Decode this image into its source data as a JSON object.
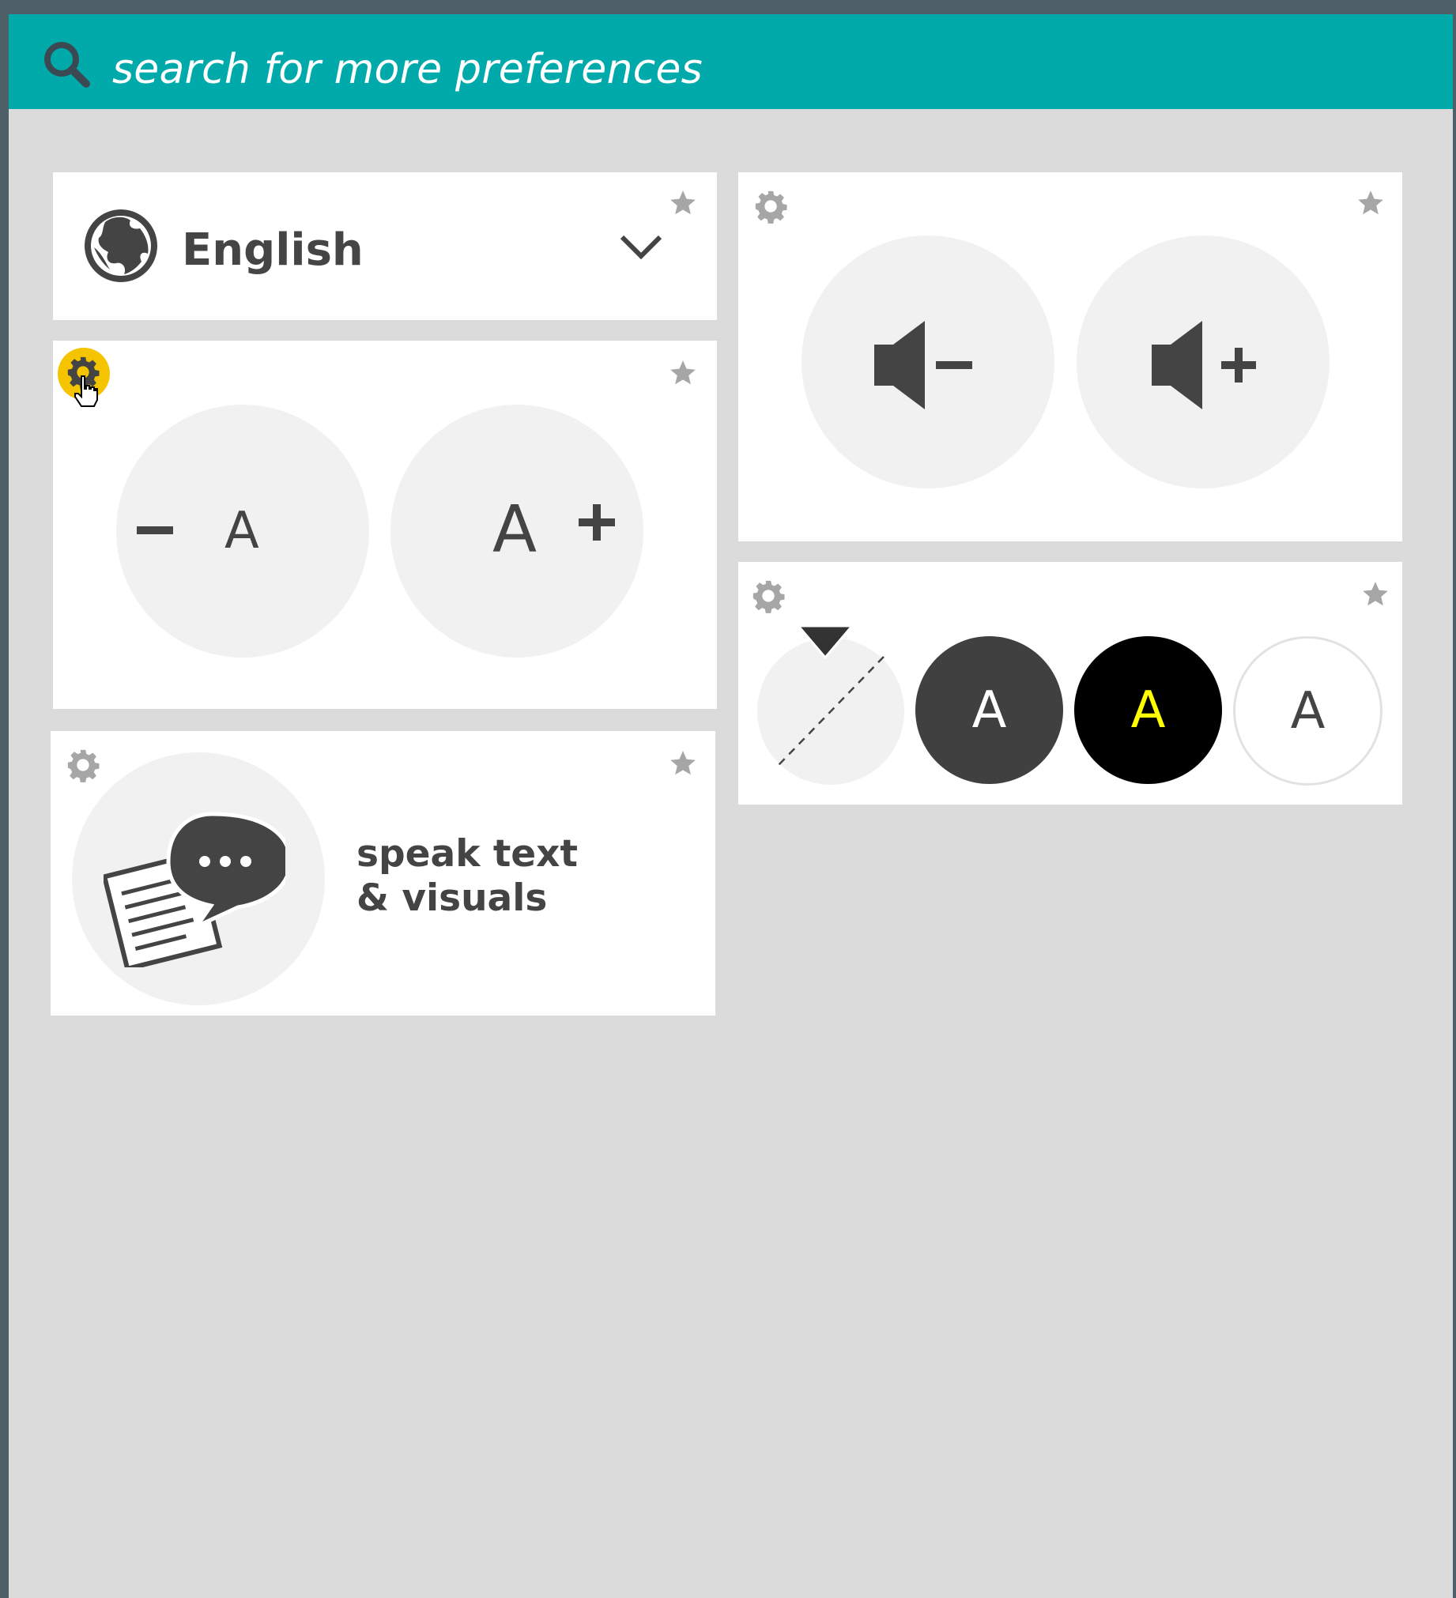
{
  "search": {
    "placeholder": "search for more preferences",
    "icon": "search-icon"
  },
  "language": {
    "selected": "English",
    "icon": "globe-icon"
  },
  "text_size": {
    "decrease_label": "A",
    "increase_label": "A",
    "decrease_symbol": "−",
    "increase_symbol": "+"
  },
  "volume": {
    "decrease_icon": "volume-down-icon",
    "increase_icon": "volume-up-icon"
  },
  "contrast": {
    "options": [
      {
        "label": "A",
        "background": "#404040",
        "text": "#ffffff"
      },
      {
        "label": "A",
        "background": "#000000",
        "text": "#ffff00"
      },
      {
        "label": "A",
        "background": "#ffffff",
        "text": "#444444"
      }
    ]
  },
  "speak": {
    "line1": "speak text",
    "line2": "& visuals"
  },
  "colors": {
    "header": "#00aaab",
    "background": "#dbdbdb",
    "highlight": "#f5c400",
    "icon": "#444444",
    "star": "#a6a6a6"
  }
}
